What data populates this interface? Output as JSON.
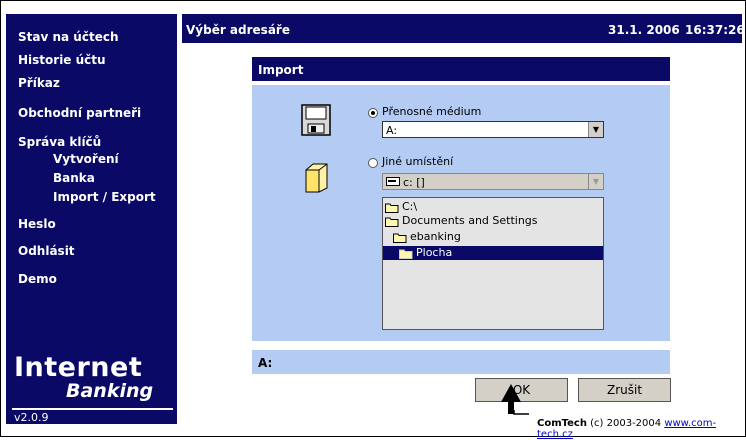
{
  "sidebar": {
    "items": [
      {
        "label": "Stav na účtech"
      },
      {
        "label": "Historie účtu"
      },
      {
        "label": "Příkaz"
      },
      {
        "label": "Obchodní partneři"
      },
      {
        "label": "Správa klíčů"
      },
      {
        "label": "Vytvoření"
      },
      {
        "label": "Banka"
      },
      {
        "label": "Import / Export"
      },
      {
        "label": "Heslo"
      },
      {
        "label": "Odhlásit"
      },
      {
        "label": "Demo"
      }
    ],
    "brand_line1": "Internet",
    "brand_line2": "Banking",
    "version": "v2.0.9"
  },
  "header": {
    "title": "Výběr adresáře",
    "date": "31.1. 2006",
    "time": "16:37:26"
  },
  "dialog": {
    "title": "Import",
    "option_removable": "Přenosné médium",
    "removable_value": "A:",
    "option_other": "Jiné umístění",
    "drive_value": "c: []",
    "tree": [
      "C:\\",
      "Documents and Settings",
      "ebanking",
      "Plocha"
    ],
    "selected_folder": "Plocha",
    "status_path": "A:"
  },
  "buttons": {
    "ok": "OK",
    "cancel": "Zrušit"
  },
  "footer": {
    "company": "ComTech",
    "copyright": "(c) 2003-2004",
    "link": "www.com-tech.cz"
  }
}
